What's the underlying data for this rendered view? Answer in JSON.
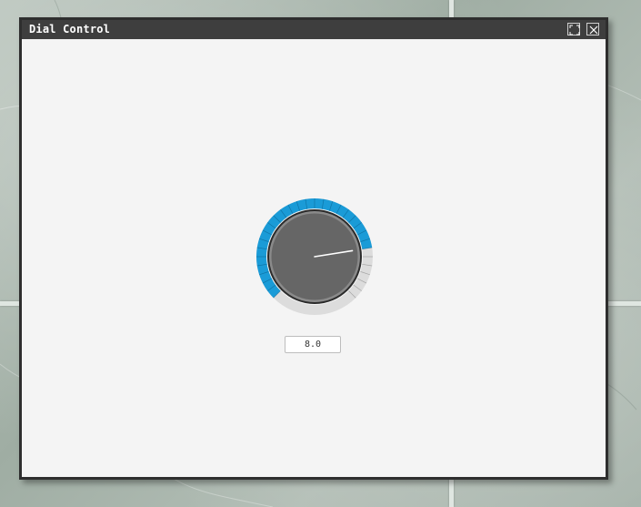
{
  "window": {
    "title": "Dial Control",
    "buttons": {
      "maximize_icon": "maximize-icon",
      "close_icon": "close-icon"
    }
  },
  "dial": {
    "value": 8.0,
    "display_value": "8.0",
    "min": 0,
    "max": 10,
    "colors": {
      "active": "#1a9bd7",
      "inactive": "#dcdcdc",
      "knob": "#666666",
      "knob_ring": "#8a8a8a",
      "needle": "#ffffff"
    }
  }
}
